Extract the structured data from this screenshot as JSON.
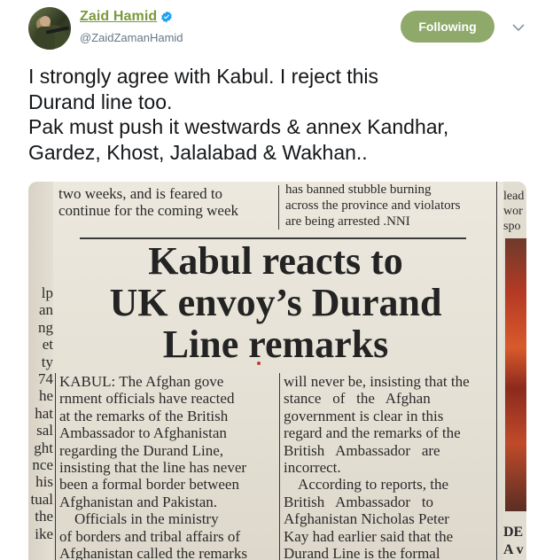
{
  "tweet": {
    "author": {
      "display_name": "Zaid Hamid",
      "handle": "@ZaidZamanHamid",
      "verified": true
    },
    "follow_button_label": "Following",
    "text_lines": [
      "I strongly agree with Kabul. I reject this",
      "Durand line too.",
      "Pak must push it westwards & annex Kandhar,",
      "Gardez, Khost, Jalalabad & Wakhan.."
    ]
  },
  "newspaper": {
    "top_left_col": [
      "two weeks, and is feared to",
      "continue for the coming week"
    ],
    "top_mid_col": [
      "has banned stubble burning",
      "across the province and violators",
      "are being arrested .NNI"
    ],
    "top_right_col": [
      "lead",
      "wor",
      "spo"
    ],
    "headline_lines": [
      "Kabul reacts to",
      "UK envoy’s Durand",
      "Line remarks"
    ],
    "left_fragments": [
      "lp",
      "an",
      "ng",
      "et",
      "ty",
      "74",
      "he",
      "hat",
      "sal",
      "ght",
      "nce",
      "his",
      "tual",
      "the",
      "ike"
    ],
    "col1_lines": [
      "KABUL: The Afghan gove",
      "rnment officials have reacted",
      "at the remarks of the British",
      "Ambassador to Afghanistan",
      "regarding the Durand Line,",
      "insisting that the line has never",
      "been a formal border between",
      "Afghanistan and Pakistan.",
      "    Officials in the ministry",
      "of borders and tribal affairs of",
      "Afghanistan called the remarks"
    ],
    "col2_lines": [
      "will never be, insisting that the",
      "stance   of   the   Afghan",
      "government is clear in this",
      "regard and the remarks of the",
      "British   Ambassador   are",
      "incorrect.",
      "    According to reports, the",
      "British   Ambassador   to",
      "Afghanistan Nicholas Peter",
      "Kay had earlier said that the",
      "Durand Line is the formal"
    ],
    "right_bottom_fragments": [
      "DE",
      "A v"
    ]
  }
}
